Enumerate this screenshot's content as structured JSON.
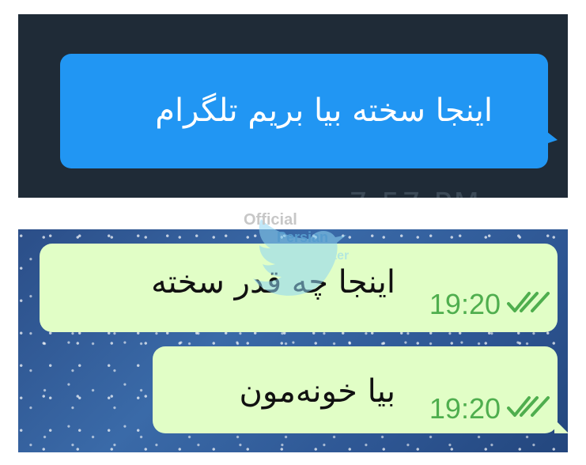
{
  "top_panel": {
    "message": "اینجا سخته بیا بریم تلگرام",
    "time": "7:57 PM",
    "colors": {
      "background": "#1f2b37",
      "bubble": "#2196f3"
    }
  },
  "bottom_panel": {
    "messages": [
      {
        "text": "اینجا چه قدر سخته",
        "time": "19:20",
        "status_icon": "double-check-icon"
      },
      {
        "text": "بیا خونه‌مون",
        "time": "19:20",
        "status_icon": "double-check-icon"
      }
    ],
    "colors": {
      "bubble": "#e1fec6",
      "time": "#4fae4e"
    }
  },
  "watermark": {
    "lines": [
      "Official",
      "Persian",
      "Twitter"
    ],
    "icon": "bird-icon"
  }
}
